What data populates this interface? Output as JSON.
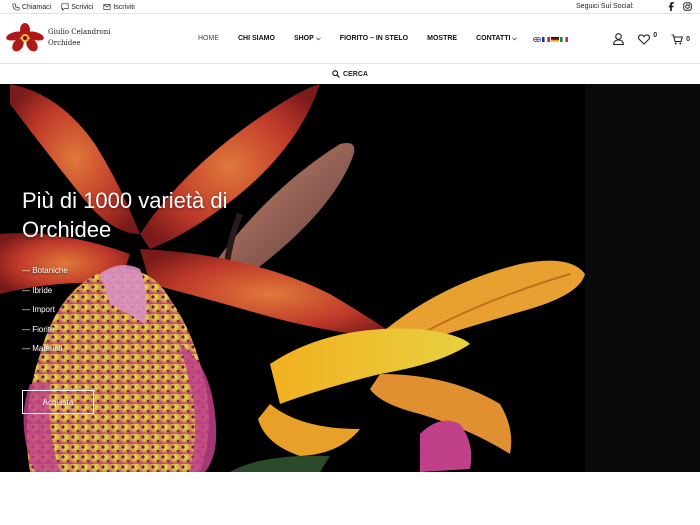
{
  "topbar": {
    "call_label": "Chiamaci",
    "write_label": "Scrivici",
    "subscribe_label": "Iscriviti",
    "social_label": "Seguici Sui Social:"
  },
  "header": {
    "logo_line1": "Giulio Celandroni",
    "logo_line2": "Orchidee",
    "nav": [
      {
        "label": "HOME"
      },
      {
        "label": "CHI SIAMO"
      },
      {
        "label": "SHOP"
      },
      {
        "label": "FIORITO – IN STELO"
      },
      {
        "label": "MOSTRE"
      },
      {
        "label": "CONTATTI"
      }
    ],
    "wishlist_count": "0",
    "cart_count": "0"
  },
  "search": {
    "label": "CERCA"
  },
  "hero": {
    "title": "Più di 1000 varietà di Orchidee",
    "items": [
      "— Botaniche",
      "— Ibride",
      "— Import",
      "— Fiorite",
      "— Materiali"
    ],
    "button_label": "Acquista"
  },
  "colors": {
    "accent": "#d61e1e",
    "hero_bg": "#000000"
  }
}
